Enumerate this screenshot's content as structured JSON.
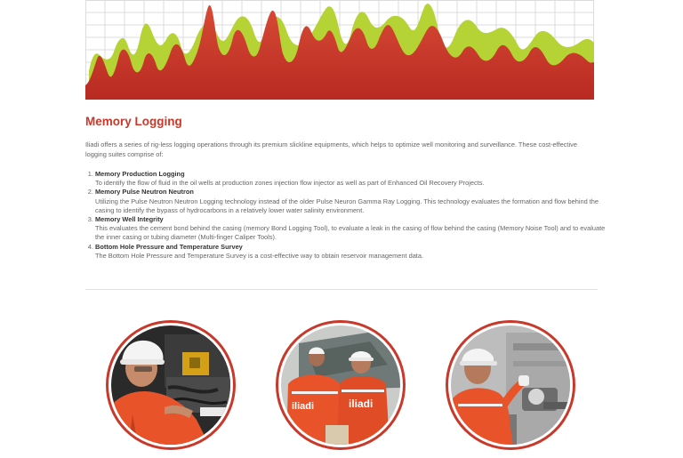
{
  "section": {
    "title": "Memory Logging",
    "intro": "Iliadi offers a series of rig-less logging operations through its premium slickline equipments, which helps to optimize well monitoring and surveillance. These cost-effective logging suites comprise of:",
    "items": [
      {
        "number": "1.",
        "title": "Memory Production Logging",
        "desc": "To identify the flow of fluid in the oil wells at production zones injection flow injector as well as part of Enhanced Oil Recovery Projects."
      },
      {
        "number": "2.",
        "title": "Memory Pulse Neutron Neutron",
        "desc": "Utilizing the Pulse Neutron Neutron Logging technology instead of the older Pulse Neuron Gamma Ray Logging. This technology evaluates the formation and flow behind the casing to identify the bypass of hydrocarbons in a relatively lower water salinity environment."
      },
      {
        "number": "3.",
        "title": "Memory Well Integrity",
        "desc": "This evaluates the cement bond behind the casing (memory Bond Logging Tool), to evaluate a leak in the casing of flow behind the casing (Memory Noise Tool) and to evaluate the inner casing or tubing diameter (Multi-finger Caliper Tools)."
      },
      {
        "number": "4.",
        "title": "Bottom Hole Pressure and Temperature Survey",
        "desc": "The Bottom Hole Pressure and Temperature Survey is a cost-effective way to obtain reservoir management data."
      }
    ]
  },
  "photos": [
    {
      "logo_text": ""
    },
    {
      "logo_text": "iliadi"
    },
    {
      "logo_text": ""
    }
  ],
  "colors": {
    "accent": "#c8392b",
    "chart_red": "#d43a2c",
    "chart_green": "#b5d334",
    "coverall_orange": "#e8532a"
  }
}
